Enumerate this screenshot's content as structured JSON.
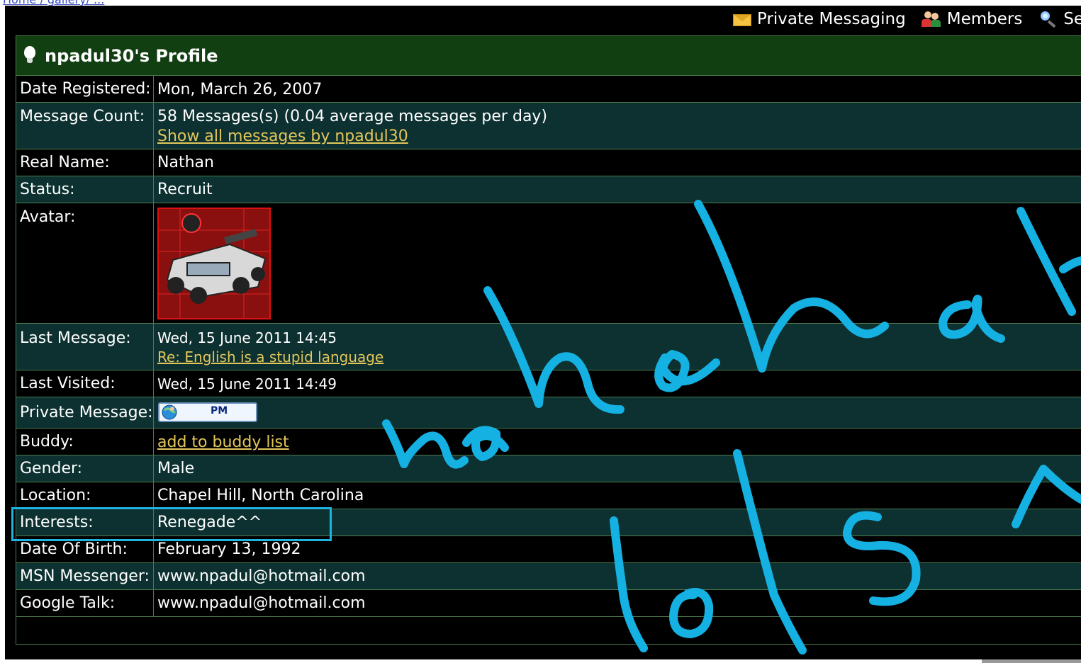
{
  "top_link": "Home / gallery/ ...",
  "toolbar": {
    "items": [
      {
        "label": "Private Messaging",
        "icon": "envelope-icon"
      },
      {
        "label": "Members",
        "icon": "members-icon"
      },
      {
        "label": "Sea",
        "icon": "search-icon"
      }
    ]
  },
  "profile": {
    "title": "npadul30's Profile",
    "rows": {
      "registered": {
        "label": "Date Registered:",
        "value": "Mon, March 26, 2007"
      },
      "messages": {
        "label": "Message Count:",
        "value": "58 Messages(s) (0.04 average messages per day)",
        "link": "Show all messages by npadul30"
      },
      "real_name": {
        "label": "Real Name:",
        "value": "Nathan"
      },
      "status": {
        "label": "Status:",
        "value": "Recruit"
      },
      "avatar": {
        "label": "Avatar:"
      },
      "last_message": {
        "label": "Last Message:",
        "value": "Wed, 15 June 2011 14:45",
        "link": "Re: English is a stupid language"
      },
      "last_visited": {
        "label": "Last Visited:",
        "value": "Wed, 15 June 2011 14:49"
      },
      "private_message": {
        "label": "Private Message:",
        "button": "PM"
      },
      "buddy": {
        "label": "Buddy:",
        "link": "add to buddy list"
      },
      "gender": {
        "label": "Gender:",
        "value": "Male"
      },
      "location": {
        "label": "Location:",
        "value": "Chapel Hill, North Carolina"
      },
      "interests": {
        "label": "Interests:",
        "value": "Renegade^^"
      },
      "dob": {
        "label": "Date Of Birth:",
        "value": "February 13, 1992"
      },
      "msn": {
        "label": "MSN Messenger:",
        "value": "www.npadul@hotmail.com"
      },
      "gtalk": {
        "label": "Google Talk:",
        "value": "www.npadul@hotmail.com"
      }
    }
  },
  "colors": {
    "header_bg": "#123f12",
    "row_teal": "#0d3131",
    "border": "#4c7a4c",
    "link": "#e3c65b",
    "annotation": "#1fb3e0"
  }
}
